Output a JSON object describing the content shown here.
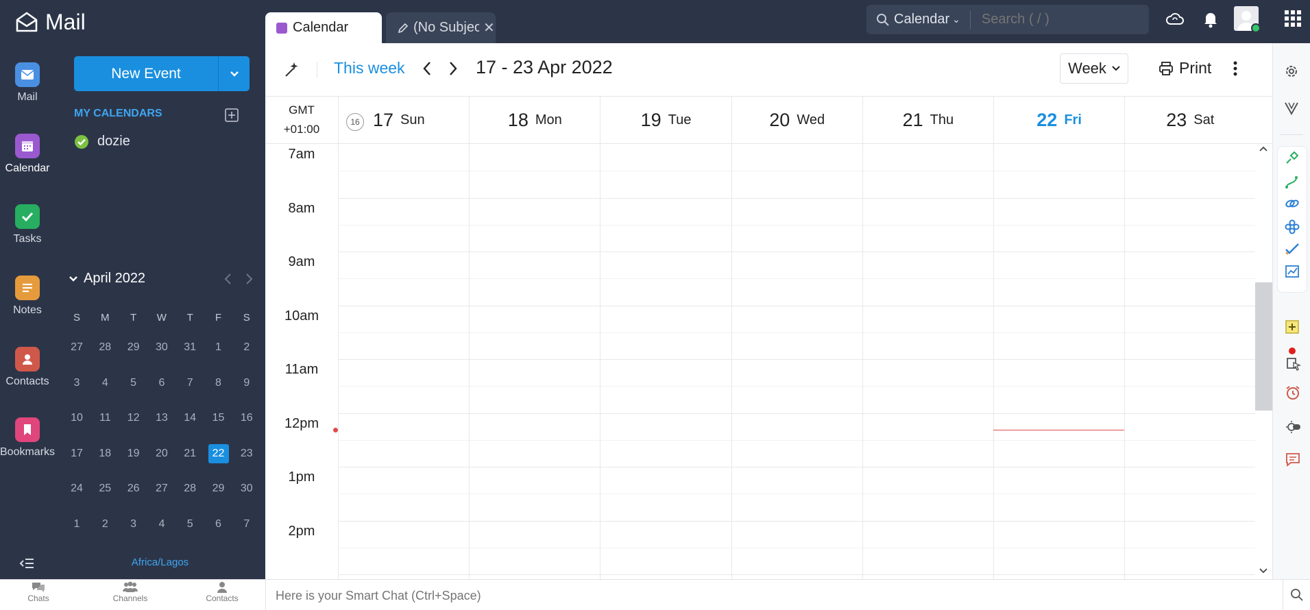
{
  "app": {
    "title": "Mail"
  },
  "tabs": [
    {
      "label": "Calendar"
    },
    {
      "label": "(No Subjec"
    }
  ],
  "search": {
    "scope": "Calendar",
    "placeholder": "Search ( / )"
  },
  "leftnav": [
    {
      "label": "Mail",
      "icon": "mail-icon",
      "color": "#4a90e2"
    },
    {
      "label": "Calendar",
      "icon": "calendar-icon",
      "color": "#9b59d0"
    },
    {
      "label": "Tasks",
      "icon": "check-icon",
      "color": "#27ae60"
    },
    {
      "label": "Notes",
      "icon": "notes-icon",
      "color": "#e59b3c"
    },
    {
      "label": "Contacts",
      "icon": "contacts-icon",
      "color": "#d0584a"
    },
    {
      "label": "Bookmarks",
      "icon": "bookmark-icon",
      "color": "#e0457b"
    }
  ],
  "sidebar": {
    "new_event_label": "New Event",
    "my_calendars_label": "MY CALENDARS",
    "calendars": [
      {
        "name": "dozie",
        "color": "#7cc142"
      }
    ],
    "mini_cal": {
      "month_label": "April 2022",
      "weekdays": [
        "S",
        "M",
        "T",
        "W",
        "T",
        "F",
        "S"
      ],
      "weeks": [
        [
          "27",
          "28",
          "29",
          "30",
          "31",
          "1",
          "2"
        ],
        [
          "3",
          "4",
          "5",
          "6",
          "7",
          "8",
          "9"
        ],
        [
          "10",
          "11",
          "12",
          "13",
          "14",
          "15",
          "16"
        ],
        [
          "17",
          "18",
          "19",
          "20",
          "21",
          "22",
          "23"
        ],
        [
          "24",
          "25",
          "26",
          "27",
          "28",
          "29",
          "30"
        ],
        [
          "1",
          "2",
          "3",
          "4",
          "5",
          "6",
          "7"
        ]
      ],
      "today": "22"
    },
    "timezone": "Africa/Lagos"
  },
  "toolbar": {
    "this_week_label": "This week",
    "date_range": "17 - 23 Apr 2022",
    "view_label": "Week",
    "print_label": "Print"
  },
  "week_header": {
    "tz_line1": "GMT",
    "tz_line2": "+01:00",
    "week_number": "16",
    "days": [
      {
        "num": "17",
        "name": "Sun",
        "today": false
      },
      {
        "num": "18",
        "name": "Mon",
        "today": false
      },
      {
        "num": "19",
        "name": "Tue",
        "today": false
      },
      {
        "num": "20",
        "name": "Wed",
        "today": false
      },
      {
        "num": "21",
        "name": "Thu",
        "today": false
      },
      {
        "num": "22",
        "name": "Fri",
        "today": true
      },
      {
        "num": "23",
        "name": "Sat",
        "today": false
      }
    ]
  },
  "hours": [
    "7am",
    "8am",
    "9am",
    "10am",
    "11am",
    "12pm",
    "1pm",
    "2pm"
  ],
  "bottombar": {
    "items": [
      "Chats",
      "Channels",
      "Contacts"
    ],
    "smartchat_placeholder": "Here is your Smart Chat (Ctrl+Space)"
  },
  "colors": {
    "accent": "#1a8fe0",
    "sidebar_bg": "#2c3548",
    "now_line": "#e04a4a"
  }
}
